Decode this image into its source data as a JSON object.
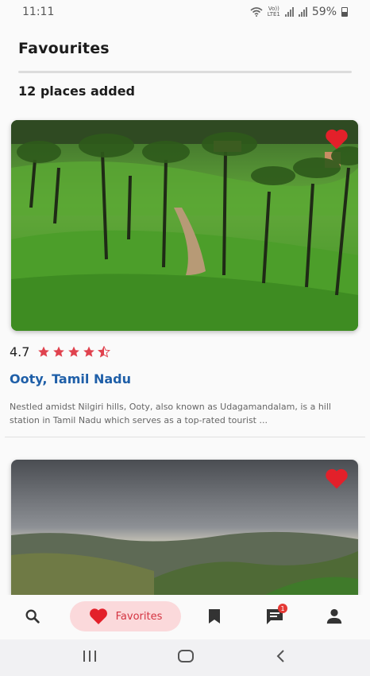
{
  "status": {
    "time": "11:11",
    "battery": "59%",
    "network": "Vo)) LTE1"
  },
  "header": {
    "title": "Favourites",
    "count_text": "12 places added"
  },
  "cards": [
    {
      "rating": "4.7",
      "stars_filled": 4.5,
      "place": "Ooty, Tamil Nadu",
      "description": "Nestled amidst Nilgiri hills, Ooty, also known as Udagamandalam, is a hill station in Tamil Nadu which serves as a top-rated tourist ..."
    },
    {
      "rating": "",
      "place": "",
      "description": ""
    }
  ],
  "bottom_nav": {
    "items": [
      "search-icon",
      "heart-icon",
      "bookmark-icon",
      "chat-icon",
      "person-icon"
    ],
    "active_label": "Favorites",
    "chat_badge": "1"
  },
  "colors": {
    "accent": "#e53946",
    "place_link": "#1f5fa8",
    "pill_bg": "#fbd9db"
  }
}
